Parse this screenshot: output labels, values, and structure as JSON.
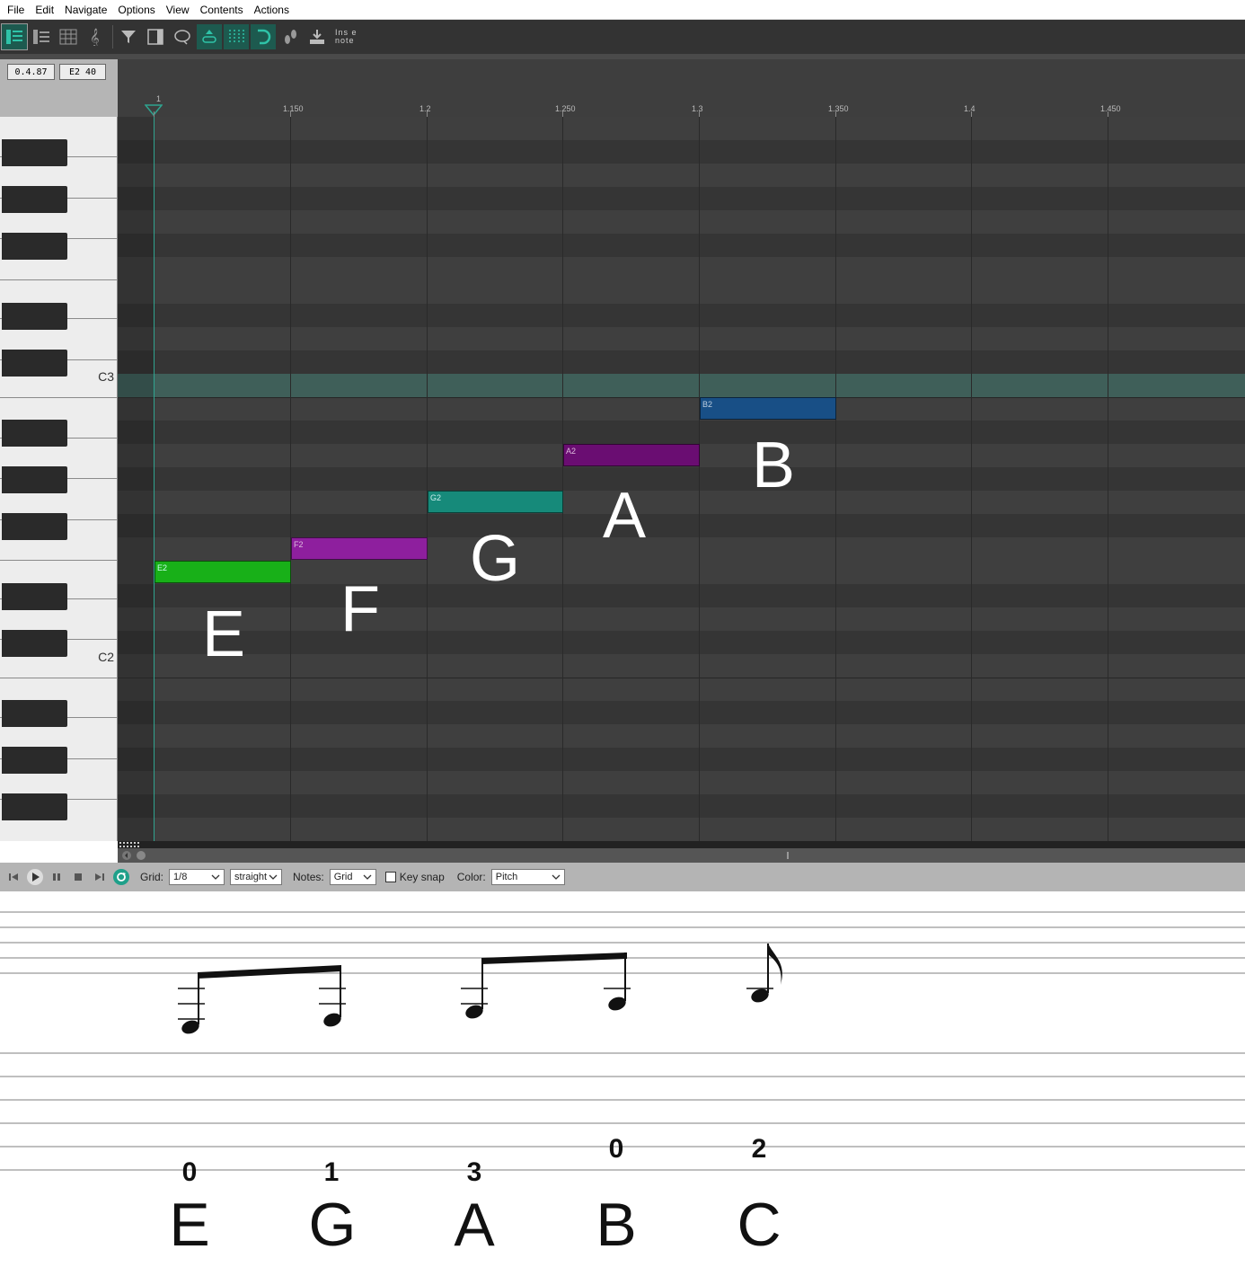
{
  "menu": [
    "File",
    "Edit",
    "Navigate",
    "Options",
    "View",
    "Contents",
    "Actions"
  ],
  "toolbar": {
    "insert_note_line1": "Ins e",
    "insert_note_line2": "note"
  },
  "info": {
    "position": "0.4.87",
    "note_velocity": "E2  40"
  },
  "keyboard": {
    "c3_label": "C3",
    "c2_label": "C2"
  },
  "ruler": {
    "labels": [
      "1",
      "1.150",
      "1.2",
      "1.250",
      "1.3",
      "1.350",
      "1.4",
      "1.450"
    ]
  },
  "notes": [
    {
      "label": "E2",
      "color": "#18b018",
      "text_color": "#cfe"
    },
    {
      "label": "F2",
      "color": "#8e1f9e",
      "text_color": "#dbd"
    },
    {
      "label": "G2",
      "color": "#168a7a",
      "text_color": "#cee"
    },
    {
      "label": "A2",
      "color": "#6a0d72",
      "text_color": "#dbd"
    },
    {
      "label": "B2",
      "color": "#184f86",
      "text_color": "#bcd"
    }
  ],
  "big_labels": [
    "E",
    "F",
    "G",
    "A",
    "B"
  ],
  "transport": {
    "grid_label": "Grid:",
    "grid_value": "1/8",
    "swing_value": "straight",
    "notes_label": "Notes:",
    "notes_value": "Grid",
    "key_snap_label": "Key snap",
    "color_label": "Color:",
    "color_value": "Pitch"
  },
  "tab": {
    "frets": [
      "0",
      "1",
      "3",
      "0",
      "2"
    ],
    "letters": [
      "E",
      "G",
      "A",
      "B",
      "C"
    ]
  }
}
